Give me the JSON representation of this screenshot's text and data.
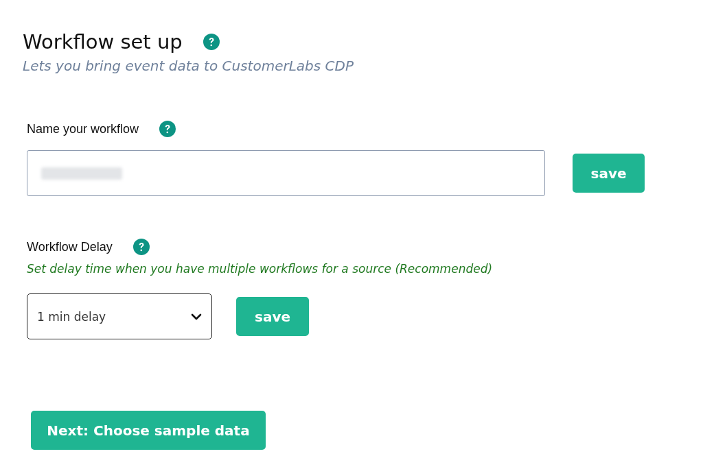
{
  "header": {
    "title": "Workflow set up",
    "subtitle": "Lets you bring event data to CustomerLabs CDP"
  },
  "name_section": {
    "label": "Name your workflow",
    "save_button": "save"
  },
  "delay_section": {
    "label": "Workflow Delay",
    "hint": "Set delay time when you have multiple workflows for a source (Recommended)",
    "select_value": "1 min delay",
    "save_button": "save"
  },
  "next_button": "Next: Choose sample data"
}
